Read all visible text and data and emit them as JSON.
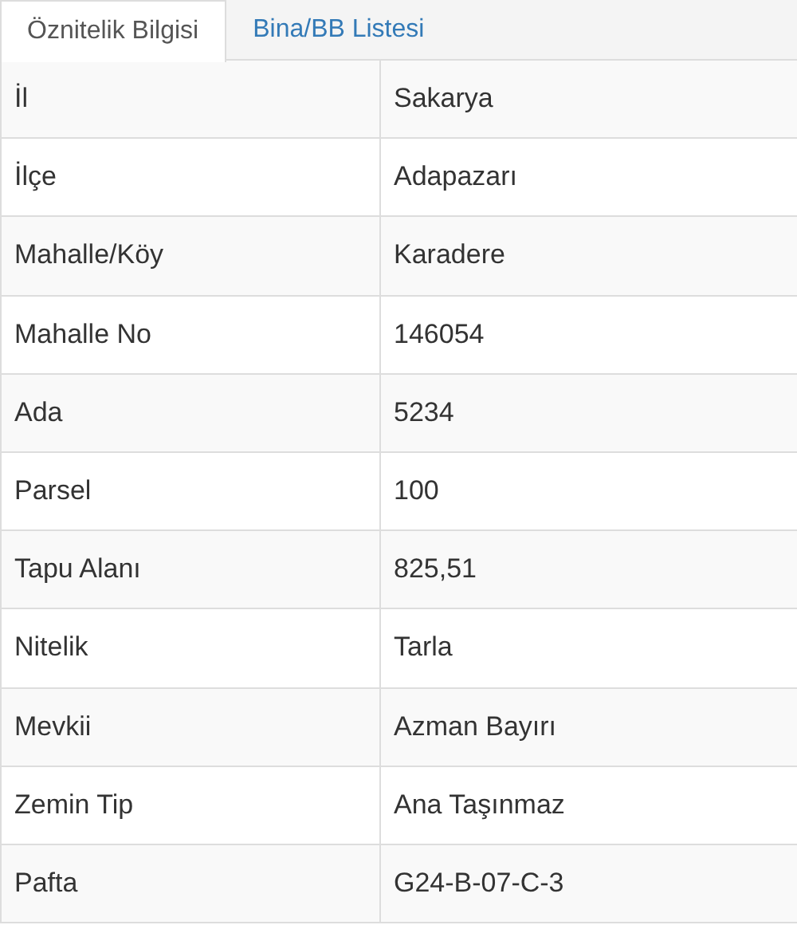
{
  "tabs": [
    {
      "label": "Öznitelik Bilgisi",
      "selected": true
    },
    {
      "label": "Bina/BB Listesi",
      "selected": false
    }
  ],
  "table": {
    "rows": [
      {
        "label": "İl",
        "value": "Sakarya"
      },
      {
        "label": "İlçe",
        "value": "Adapazarı"
      },
      {
        "label": "Mahalle/Köy",
        "value": "Karadere"
      },
      {
        "label": "Mahalle No",
        "value": "146054"
      },
      {
        "label": "Ada",
        "value": "5234"
      },
      {
        "label": "Parsel",
        "value": "100"
      },
      {
        "label": "Tapu Alanı",
        "value": "825,51"
      },
      {
        "label": "Nitelik",
        "value": "Tarla"
      },
      {
        "label": "Mevkii",
        "value": "Azman Bayırı"
      },
      {
        "label": "Zemin Tip",
        "value": "Ana Taşınmaz"
      },
      {
        "label": "Pafta",
        "value": "G24-B-07-C-3"
      }
    ]
  }
}
